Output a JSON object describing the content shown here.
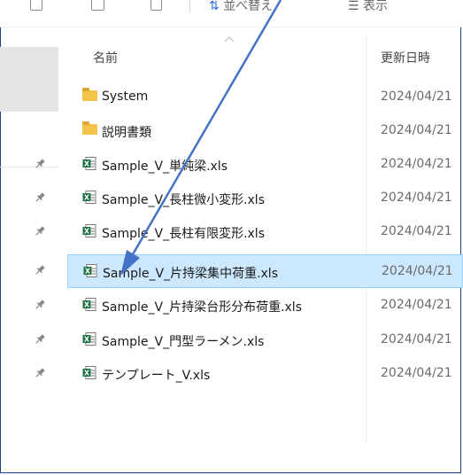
{
  "toolbar": {
    "sort_label": "並べ替え",
    "view_label": "表示"
  },
  "columns": {
    "name_header": "名前",
    "date_header": "更新日時"
  },
  "files": [
    {
      "name": "System",
      "type": "folder",
      "date": "2024/04/21"
    },
    {
      "name": "説明書類",
      "type": "folder",
      "date": "2024/04/21"
    },
    {
      "name": "Sample_V_単純梁.xls",
      "type": "excel",
      "date": "2024/04/21"
    },
    {
      "name": "Sample_V_長柱微小変形.xls",
      "type": "excel",
      "date": "2024/04/21"
    },
    {
      "name": "Sample_V_長柱有限変形.xls",
      "type": "excel",
      "date": "2024/04/21"
    },
    {
      "name": "Sample_V_片持梁集中荷重.xls",
      "type": "excel",
      "date": "2024/04/21",
      "selected": true
    },
    {
      "name": "Sample_V_片持梁台形分布荷重.xls",
      "type": "excel",
      "date": "2024/04/21"
    },
    {
      "name": "Sample_V_門型ラーメン.xls",
      "type": "excel",
      "date": "2024/04/21"
    },
    {
      "name": "テンプレート_V.xls",
      "type": "excel",
      "date": "2024/04/21"
    }
  ],
  "colors": {
    "selection_bg": "#cce8ff",
    "selection_border": "#99d1ff",
    "arrow": "#4472c4",
    "folder": "#f3c24a",
    "excel_green": "#1d6f42"
  },
  "icons": {
    "folder": "folder-icon",
    "excel": "excel-file-icon",
    "pin": "pin-icon"
  }
}
